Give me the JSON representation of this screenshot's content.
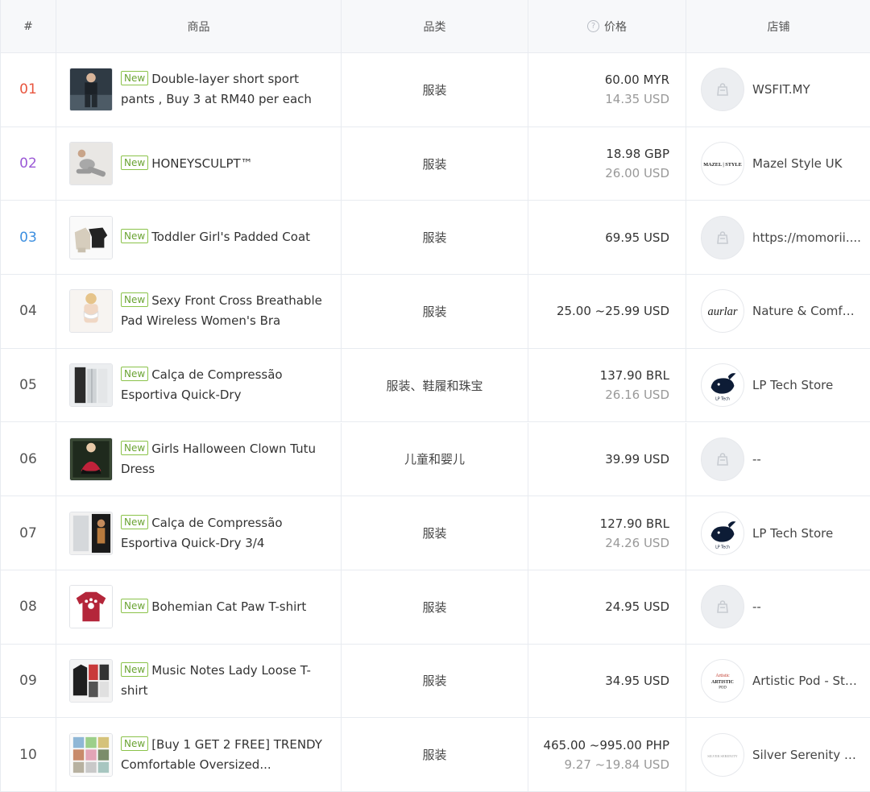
{
  "header": {
    "rank": "#",
    "product": "商品",
    "category": "品类",
    "price": "价格",
    "shop": "店铺"
  },
  "badge_label": "New",
  "rank_colors": {
    "01": "#e8553e",
    "02": "#9b59d6",
    "03": "#3d8fe0",
    "default": "#555555"
  },
  "rows": [
    {
      "rank": "01",
      "title": "Double-layer short sport pants , Buy 3 at RM40 per each",
      "category": "服装",
      "price": "60.00 MYR",
      "price_usd": "14.35 USD",
      "shop": "WSFIT.MY",
      "logo": "placeholder-shop-icon"
    },
    {
      "rank": "02",
      "title": "HONEYSCULPT™",
      "category": "服装",
      "price": "18.98 GBP",
      "price_usd": "26.00 USD",
      "shop": "Mazel Style UK",
      "logo": "mazel-style-logo"
    },
    {
      "rank": "03",
      "title": "Toddler Girl's Padded Coat",
      "category": "服装",
      "price": "69.95 USD",
      "price_usd": "",
      "shop": "https://momorii....",
      "logo": "placeholder-shop-icon"
    },
    {
      "rank": "04",
      "title": "Sexy Front Cross Breathable Pad Wireless Women's Bra",
      "category": "服装",
      "price": "25.00 ~25.99 USD",
      "price_usd": "",
      "shop": "Nature & Comfor...",
      "logo": "aurlar-logo"
    },
    {
      "rank": "05",
      "title": "Calça de Compressão Esportiva Quick-Dry",
      "category": "服装、鞋履和珠宝",
      "price": "137.90 BRL",
      "price_usd": "26.16 USD",
      "shop": "LP Tech Store",
      "logo": "lp-tech-logo"
    },
    {
      "rank": "06",
      "title": "Girls Halloween Clown Tutu Dress",
      "category": "儿童和婴儿",
      "price": "39.99 USD",
      "price_usd": "",
      "shop": "--",
      "logo": "placeholder-shop-icon"
    },
    {
      "rank": "07",
      "title": "Calça de Compressão Esportiva Quick-Dry 3/4",
      "category": "服装",
      "price": "127.90 BRL",
      "price_usd": "24.26 USD",
      "shop": "LP Tech Store",
      "logo": "lp-tech-logo"
    },
    {
      "rank": "08",
      "title": "Bohemian Cat Paw T-shirt",
      "category": "服装",
      "price": "24.95 USD",
      "price_usd": "",
      "shop": "--",
      "logo": "placeholder-shop-icon"
    },
    {
      "rank": "09",
      "title": "Music Notes Lady Loose T-shirt",
      "category": "服装",
      "price": "34.95 USD",
      "price_usd": "",
      "shop": "Artistic Pod - Sto...",
      "logo": "artistic-pod-logo"
    },
    {
      "rank": "10",
      "title": "[Buy 1 GET 2 FREE] TRENDY Comfortable Oversized...",
      "category": "服装",
      "price": "465.00 ~995.00 PHP",
      "price_usd": "9.27 ~19.84 USD",
      "shop": "Silver Serenity S...",
      "logo": "silver-serenity-logo"
    }
  ]
}
